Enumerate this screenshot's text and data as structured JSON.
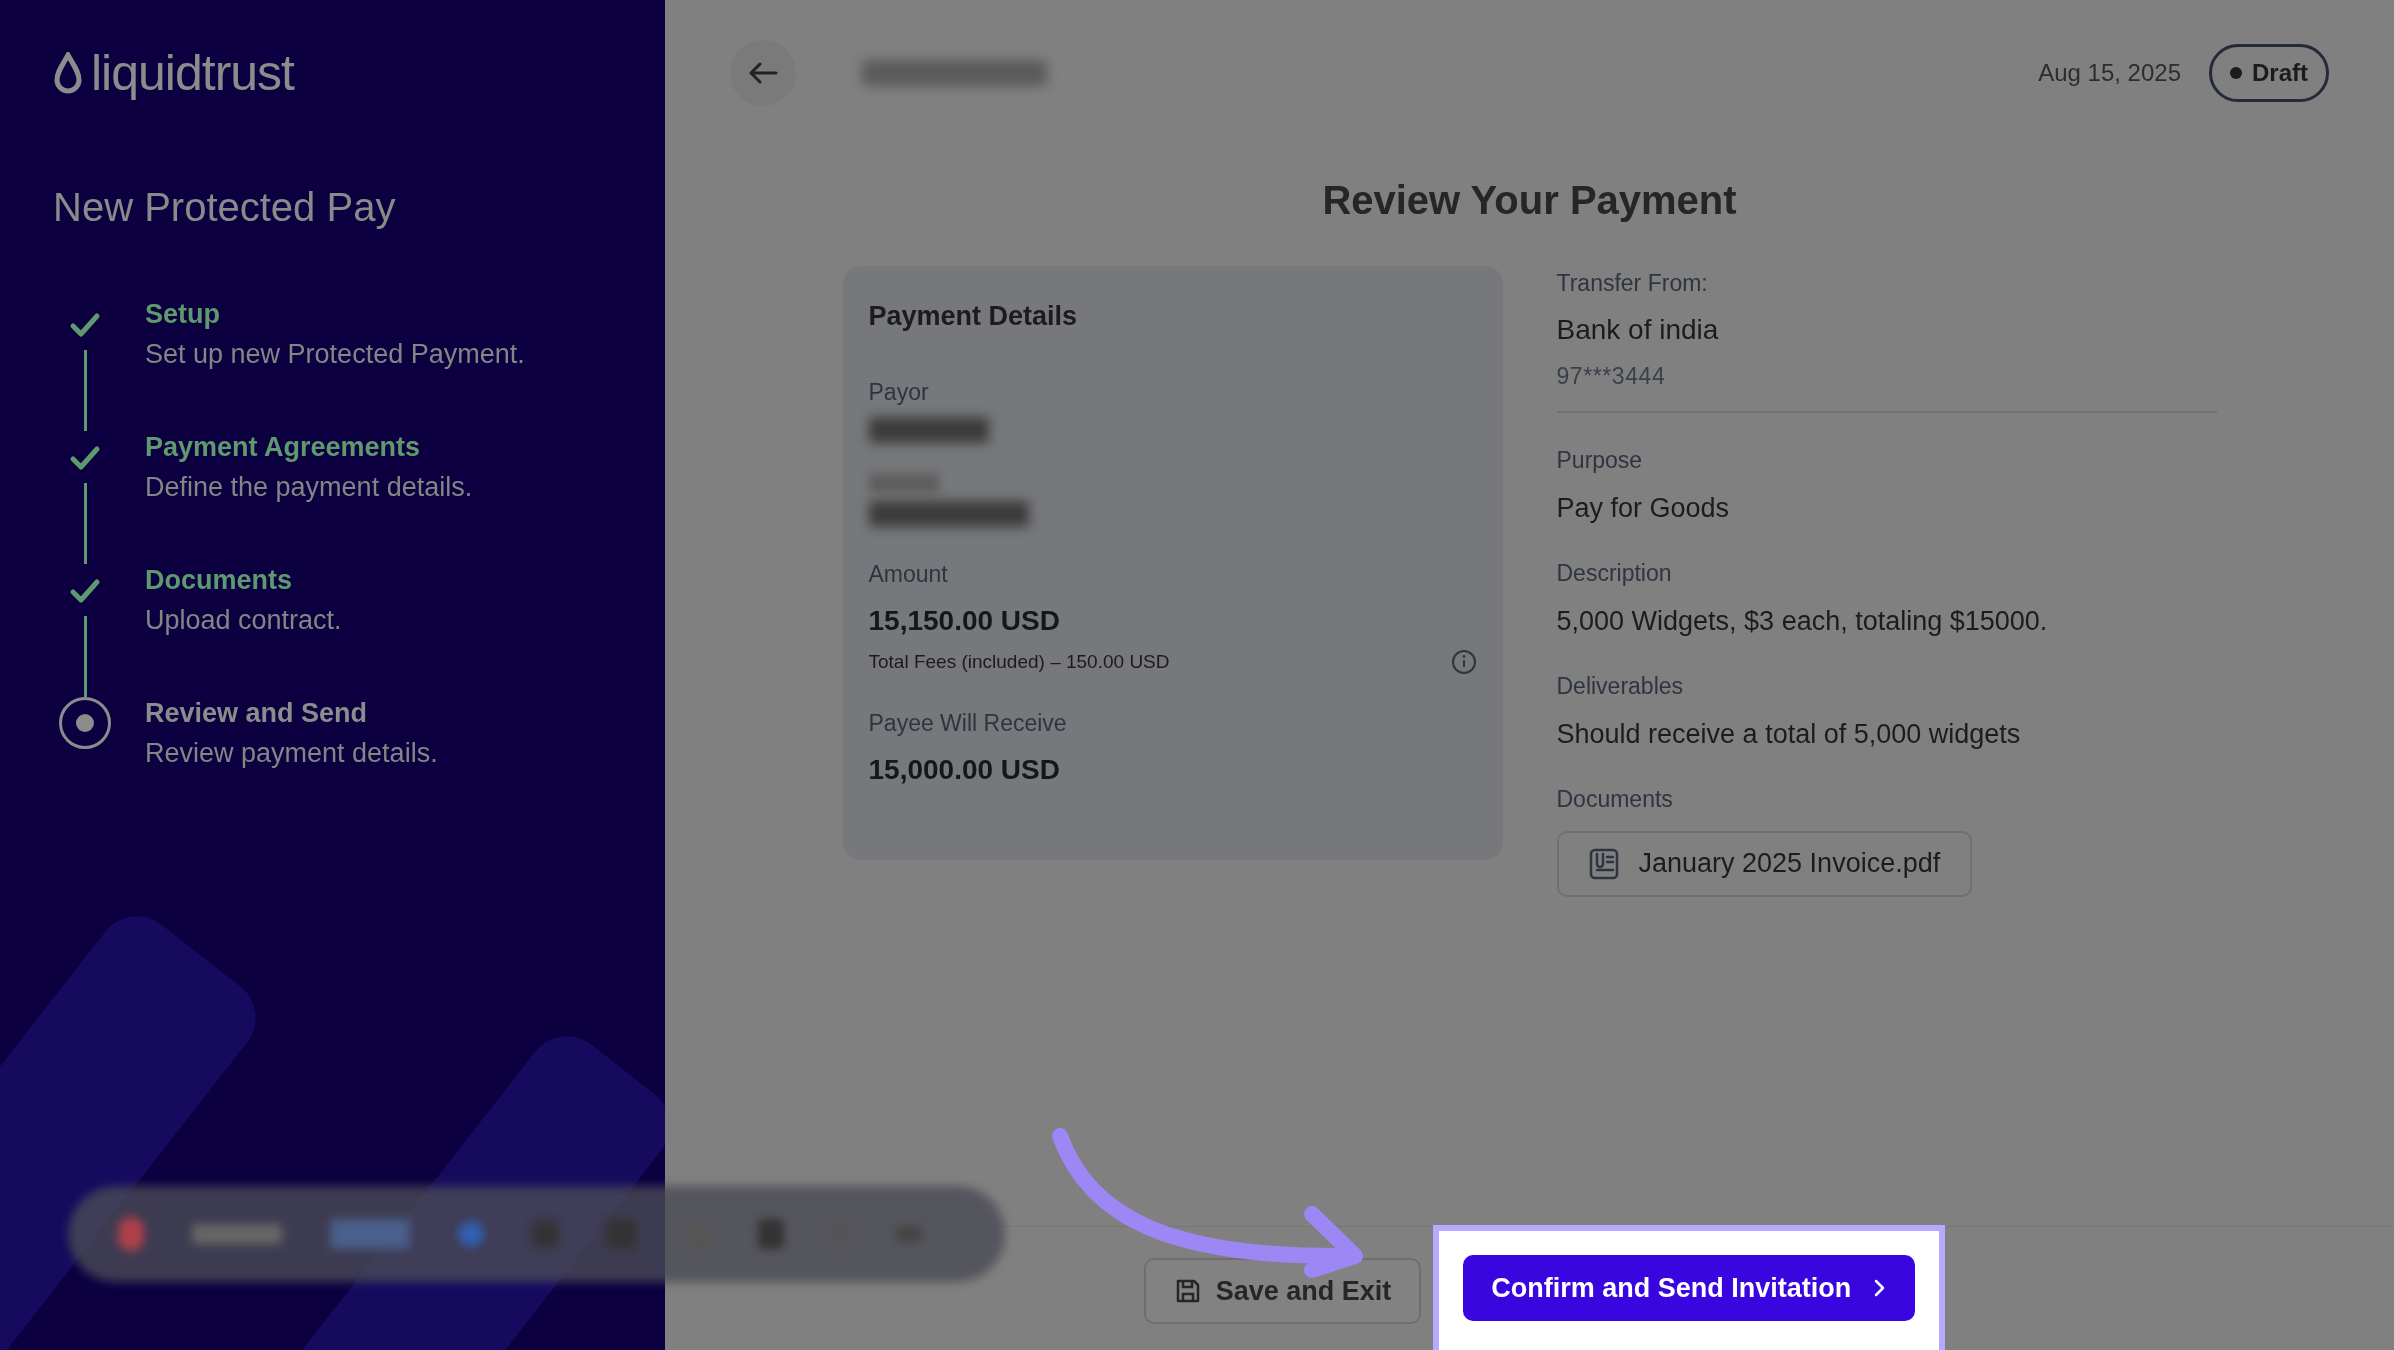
{
  "sidebar": {
    "logo": "liquidtrust",
    "title": "New Protected Pay",
    "steps": [
      {
        "title": "Setup",
        "description": "Set up new Protected Payment.",
        "done": true
      },
      {
        "title": "Payment Agreements",
        "description": "Define the payment details.",
        "done": true
      },
      {
        "title": "Documents",
        "description": "Upload contract.",
        "done": true
      },
      {
        "title": "Review and Send",
        "description": "Review payment details.",
        "done": false
      }
    ]
  },
  "header": {
    "date": "Aug 15, 2025",
    "status_badge": "Draft"
  },
  "heading": "Review Your Payment",
  "payment_details": {
    "title": "Payment Details",
    "fields": [
      {
        "kind": "hidden_value",
        "label": "Payor"
      },
      {
        "kind": "hidden"
      },
      {
        "kind": "amount",
        "label": "Amount",
        "value": "15,150.00 USD",
        "note": "Total Fees (included) – 150.00 USD"
      },
      {
        "kind": "amount",
        "label": "Payee Will Receive",
        "value": "15,000.00 USD"
      }
    ]
  },
  "transfer": {
    "label": "Transfer From:",
    "bank": "Bank of india",
    "account": "97***3444"
  },
  "details": [
    {
      "label": "Purpose",
      "value": "Pay for Goods"
    },
    {
      "label": "Description",
      "value": "5,000 Widgets, $3 each, totaling $15000."
    },
    {
      "label": "Deliverables",
      "value": "Should receive a total of 5,000 widgets"
    }
  ],
  "documents": {
    "label": "Documents",
    "files": [
      "January 2025 Invoice.pdf"
    ]
  },
  "footer": {
    "secondary_button": "Save and Exit",
    "primary_button": "Confirm and Send Invitation",
    "primary_highlighted": true
  }
}
